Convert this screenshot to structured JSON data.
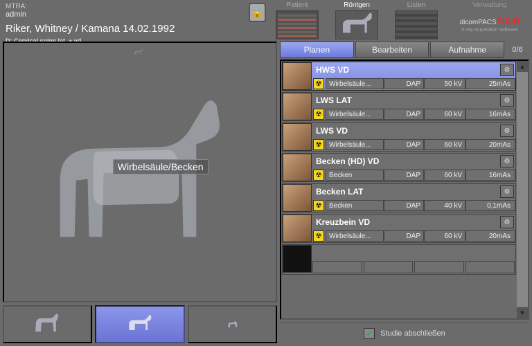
{
  "header": {
    "mtra_label": "MTRA:",
    "mtra_user": "admin",
    "patient": "Riker, Whitney / Kamana  14.02.1992",
    "subtitle": "D: Cervical spine lat. + vd"
  },
  "nav": {
    "patient": "Patient",
    "roentgen": "Röntgen",
    "listen": "Listen",
    "verwaltung": "Verwaltung"
  },
  "logo": {
    "brand": "dicomPACS",
    "dx": "DX-R",
    "sub": "X-ray Acquisition Software"
  },
  "region_label": "Wirbelsäule/Becken",
  "tabs": {
    "planen": "Planen",
    "bearbeiten": "Bearbeiten",
    "aufnahme": "Aufnahme",
    "count": "0/6"
  },
  "exams": [
    {
      "title": "HWS VD",
      "cat": "Wirbelsäule...",
      "dap": "DAP",
      "kv": "50 kV",
      "mas": "25mAs",
      "selected": true
    },
    {
      "title": "LWS LAT",
      "cat": "Wirbelsäule...",
      "dap": "DAP",
      "kv": "60 kV",
      "mas": "16mAs",
      "selected": false
    },
    {
      "title": "LWS VD",
      "cat": "Wirbelsäule...",
      "dap": "DAP",
      "kv": "60 kV",
      "mas": "20mAs",
      "selected": false
    },
    {
      "title": "Becken (HD) VD",
      "cat": "Becken",
      "dap": "DAP",
      "kv": "60 kV",
      "mas": "16mAs",
      "selected": false
    },
    {
      "title": "Becken LAT",
      "cat": "Becken",
      "dap": "DAP",
      "kv": "40 kV",
      "mas": "0,1mAs",
      "selected": false
    },
    {
      "title": "Kreuzbein VD",
      "cat": "Wirbelsäule...",
      "dap": "DAP",
      "kv": "60 kV",
      "mas": "20mAs",
      "selected": false
    }
  ],
  "finish": "Studie abschließen"
}
